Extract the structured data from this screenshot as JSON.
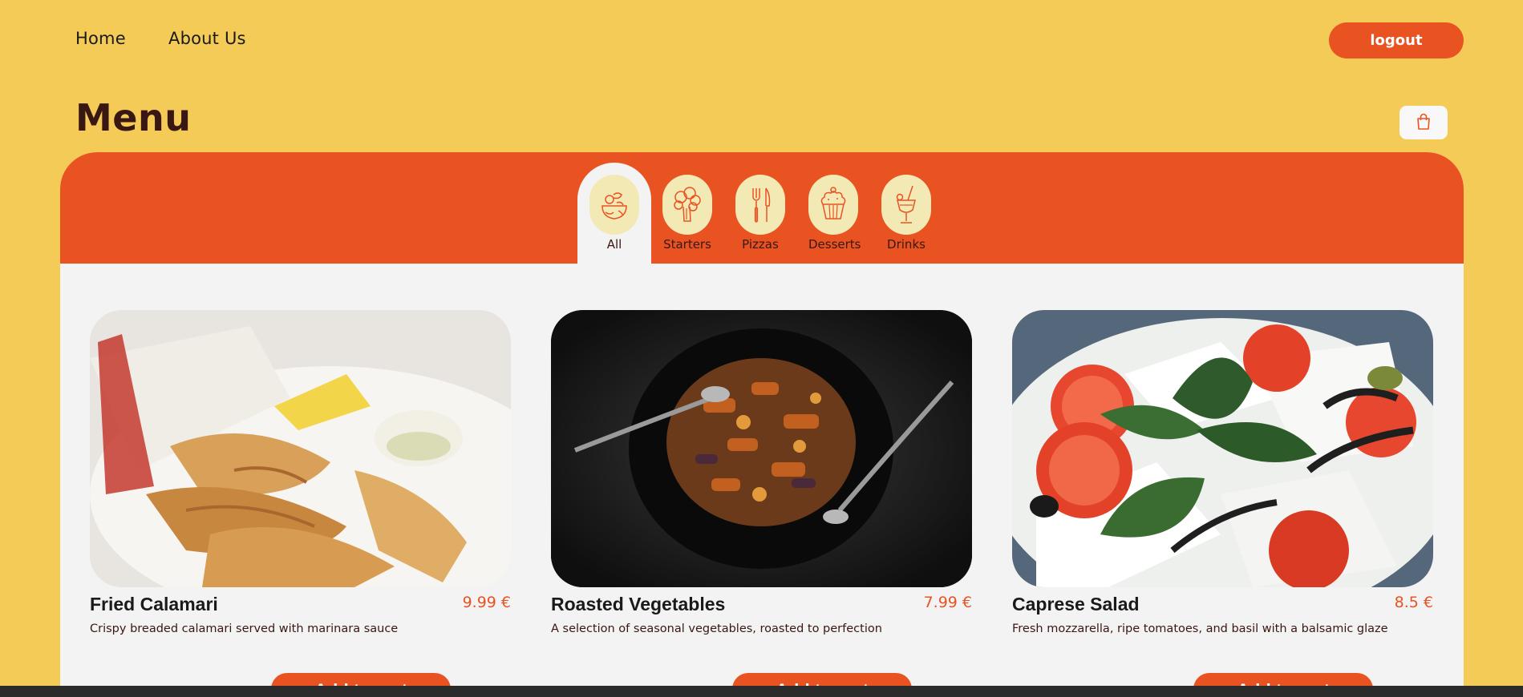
{
  "nav": {
    "home_label": "Home",
    "about_label": "About Us",
    "logout_label": "logout"
  },
  "page": {
    "title": "Menu"
  },
  "tabs": [
    {
      "label": "All",
      "icon": "mixed-food-icon",
      "active": true
    },
    {
      "label": "Starters",
      "icon": "broccoli-icon",
      "active": false
    },
    {
      "label": "Pizzas",
      "icon": "fork-knife-icon",
      "active": false
    },
    {
      "label": "Desserts",
      "icon": "cupcake-icon",
      "active": false
    },
    {
      "label": "Drinks",
      "icon": "cocktail-icon",
      "active": false
    }
  ],
  "items": [
    {
      "name": "Fried Calamari",
      "price": "9.99 €",
      "description": "Crispy breaded calamari served with marinara sauce",
      "button": "Add to cart"
    },
    {
      "name": "Roasted Vegetables",
      "price": "7.99 €",
      "description": "A selection of seasonal vegetables, roasted to perfection",
      "button": "Add to cart"
    },
    {
      "name": "Caprese Salad",
      "price": "8.5 €",
      "description": "Fresh mozzarella, ripe tomatoes, and basil with a balsamic glaze",
      "button": "Add to cart"
    }
  ],
  "colors": {
    "background": "#f5cb58",
    "accent": "#e95322",
    "panel": "#f3f3f3",
    "tab_icon_bg": "#f3e9b5",
    "dark_text": "#391713"
  }
}
